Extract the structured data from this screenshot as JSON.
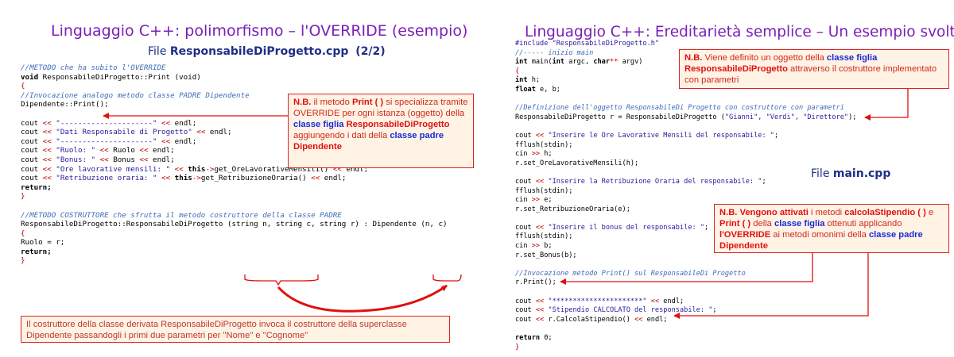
{
  "left": {
    "title": "Linguaggio C++: polimorfismo – l'OVERRIDE (esempio)",
    "file_prefix": "File ",
    "file_name": "ResponsabileDiProgetto.cpp",
    "file_page": "(2/2)",
    "code": [
      {
        "t": "cm",
        "v": "//METODO che ha subito l'OVERRIDE"
      },
      {
        "t": "mix",
        "parts": [
          [
            "kw",
            "void"
          ],
          [
            "n",
            " ResponsabileDiProgetto::Print (void)"
          ]
        ]
      },
      {
        "t": "op",
        "v": "{"
      },
      {
        "t": "cm",
        "v": "//Invocazione analogo metodo classe PADRE Dipendente"
      },
      {
        "t": "n",
        "v": "Dipendente::Print();"
      },
      {
        "t": "n",
        "v": ""
      },
      {
        "t": "mix",
        "parts": [
          [
            "n",
            "cout "
          ],
          [
            "op",
            "<<"
          ],
          [
            "st",
            " \"---------------------\" "
          ],
          [
            "op",
            "<<"
          ],
          [
            "n",
            " endl;"
          ]
        ]
      },
      {
        "t": "mix",
        "parts": [
          [
            "n",
            "cout "
          ],
          [
            "op",
            "<<"
          ],
          [
            "st",
            " \"Dati Responsabile di Progetto\" "
          ],
          [
            "op",
            "<<"
          ],
          [
            "n",
            " endl;"
          ]
        ]
      },
      {
        "t": "mix",
        "parts": [
          [
            "n",
            "cout "
          ],
          [
            "op",
            "<<"
          ],
          [
            "st",
            " \"---------------------\" "
          ],
          [
            "op",
            "<<"
          ],
          [
            "n",
            " endl;"
          ]
        ]
      },
      {
        "t": "mix",
        "parts": [
          [
            "n",
            "cout "
          ],
          [
            "op",
            "<<"
          ],
          [
            "st",
            " \"Ruolo: \" "
          ],
          [
            "op",
            "<<"
          ],
          [
            "n",
            " Ruolo "
          ],
          [
            "op",
            "<<"
          ],
          [
            "n",
            " endl;"
          ]
        ]
      },
      {
        "t": "mix",
        "parts": [
          [
            "n",
            "cout "
          ],
          [
            "op",
            "<<"
          ],
          [
            "st",
            " \"Bonus: \" "
          ],
          [
            "op",
            "<<"
          ],
          [
            "n",
            " Bonus "
          ],
          [
            "op",
            "<<"
          ],
          [
            "n",
            " endl;"
          ]
        ]
      },
      {
        "t": "mix",
        "parts": [
          [
            "n",
            "cout "
          ],
          [
            "op",
            "<<"
          ],
          [
            "st",
            " \"Ore lavorative mensili: \" "
          ],
          [
            "op",
            "<<"
          ],
          [
            "kw",
            " this"
          ],
          [
            "op",
            "->"
          ],
          [
            "n",
            "get_OreLavorativeMensili() "
          ],
          [
            "op",
            "<<"
          ],
          [
            "n",
            " endl;"
          ]
        ]
      },
      {
        "t": "mix",
        "parts": [
          [
            "n",
            "cout "
          ],
          [
            "op",
            "<<"
          ],
          [
            "st",
            " \"Retribuzione oraria: \" "
          ],
          [
            "op",
            "<<"
          ],
          [
            "kw",
            " this"
          ],
          [
            "op",
            "->"
          ],
          [
            "n",
            "get_RetribuzioneOraria() "
          ],
          [
            "op",
            "<<"
          ],
          [
            "n",
            " endl;"
          ]
        ]
      },
      {
        "t": "kw",
        "v": "return;"
      },
      {
        "t": "op",
        "v": "}"
      },
      {
        "t": "n",
        "v": ""
      },
      {
        "t": "cm",
        "v": "//METODO COSTRUTTORE che sfrutta il metodo costruttore della classe PADRE"
      },
      {
        "t": "n",
        "v": "ResponsabileDiProgetto::ResponsabileDiProgetto (string n, string c, string r) : Dipendente (n, c)"
      },
      {
        "t": "op",
        "v": "{"
      },
      {
        "t": "n",
        "v": "Ruolo = r;"
      },
      {
        "t": "kw",
        "v": "return;"
      },
      {
        "t": "op",
        "v": "}"
      }
    ],
    "note1": {
      "nb": "N.B.",
      "a": " il metodo ",
      "b": "Print ( )",
      "c": " si specializza tramite OVERRIDE per ogni istanza (oggetto) della ",
      "d": "classe figlia",
      "e": " ",
      "f": "ResponsabileDiProgetto",
      "g": " aggiungendo i dati della ",
      "h": "classe padre",
      "i": " ",
      "j": "Dipendente"
    },
    "note2": {
      "a": "Il costruttore della ",
      "b": "classe derivata",
      "c": " ",
      "d": "ResponsabileDiProgetto",
      "e": " invoca il costruttore della ",
      "f": "superclasse",
      "g": " ",
      "h": "Dipendente",
      "i": " passandogli i primi due parametri per \"Nome\" e \"Cognome\""
    }
  },
  "right": {
    "title": "Linguaggio C++: Ereditarietà semplice – Un esempio svolto",
    "file_prefix": "File ",
    "file_name": "main.cpp",
    "code": [
      {
        "t": "st",
        "v": "#include \"ResponsabileDiProgetto.h\""
      },
      {
        "t": "cm",
        "v": "//----- inizio main"
      },
      {
        "t": "mix",
        "parts": [
          [
            "kw",
            "int"
          ],
          [
            "n",
            " main("
          ],
          [
            "kw",
            "int"
          ],
          [
            "n",
            " argc, "
          ],
          [
            "kw",
            "char"
          ],
          [
            "op",
            "**"
          ],
          [
            "n",
            " argv)"
          ]
        ]
      },
      {
        "t": "op",
        "v": "{"
      },
      {
        "t": "mix",
        "parts": [
          [
            "kw",
            "int"
          ],
          [
            "n",
            " h;"
          ]
        ]
      },
      {
        "t": "mix",
        "parts": [
          [
            "kw",
            "float"
          ],
          [
            "n",
            " e, b;"
          ]
        ]
      },
      {
        "t": "n",
        "v": ""
      },
      {
        "t": "cm",
        "v": "//Definizione dell'oggetto ResponsabileDi Progetto con costruttore con parametri"
      },
      {
        "t": "mix",
        "parts": [
          [
            "n",
            "ResponsabileDiProgetto r = ResponsabileDiProgetto ("
          ],
          [
            "st",
            "\"Gianni\", \"Verdi\", \"Direttore\""
          ],
          [
            "n",
            ");"
          ]
        ]
      },
      {
        "t": "n",
        "v": ""
      },
      {
        "t": "mix",
        "parts": [
          [
            "n",
            "cout "
          ],
          [
            "op",
            "<<"
          ],
          [
            "st",
            " \"Inserire le Ore Lavorative Mensili del responsabile: \""
          ],
          [
            "n",
            ";"
          ]
        ]
      },
      {
        "t": "n",
        "v": "fflush(stdin);"
      },
      {
        "t": "mix",
        "parts": [
          [
            "n",
            "cin "
          ],
          [
            "op",
            ">>"
          ],
          [
            "n",
            " h;"
          ]
        ]
      },
      {
        "t": "n",
        "v": "r.set_OreLavorativeMensili(h);"
      },
      {
        "t": "n",
        "v": ""
      },
      {
        "t": "mix",
        "parts": [
          [
            "n",
            "cout "
          ],
          [
            "op",
            "<<"
          ],
          [
            "st",
            " \"Inserire la Retribuzione Oraria del responsabile: \""
          ],
          [
            "n",
            ";"
          ]
        ]
      },
      {
        "t": "n",
        "v": "fflush(stdin);"
      },
      {
        "t": "mix",
        "parts": [
          [
            "n",
            "cin "
          ],
          [
            "op",
            ">>"
          ],
          [
            "n",
            " e;"
          ]
        ]
      },
      {
        "t": "n",
        "v": "r.set_RetribuzioneOraria(e);"
      },
      {
        "t": "n",
        "v": ""
      },
      {
        "t": "mix",
        "parts": [
          [
            "n",
            "cout "
          ],
          [
            "op",
            "<<"
          ],
          [
            "st",
            " \"Inserire il bonus del responsabile: \""
          ],
          [
            "n",
            ";"
          ]
        ]
      },
      {
        "t": "n",
        "v": "fflush(stdin);"
      },
      {
        "t": "mix",
        "parts": [
          [
            "n",
            "cin "
          ],
          [
            "op",
            ">>"
          ],
          [
            "n",
            " b;"
          ]
        ]
      },
      {
        "t": "n",
        "v": "r.set_Bonus(b);"
      },
      {
        "t": "n",
        "v": ""
      },
      {
        "t": "cm",
        "v": "//Invocazione metodo Print() sul ResponsabileDi Progetto"
      },
      {
        "t": "n",
        "v": "r.Print();"
      },
      {
        "t": "n",
        "v": ""
      },
      {
        "t": "mix",
        "parts": [
          [
            "n",
            "cout "
          ],
          [
            "op",
            "<<"
          ],
          [
            "st",
            " \"**********************\" "
          ],
          [
            "op",
            "<<"
          ],
          [
            "n",
            " endl;"
          ]
        ]
      },
      {
        "t": "mix",
        "parts": [
          [
            "n",
            "cout "
          ],
          [
            "op",
            "<<"
          ],
          [
            "st",
            " \"Stipendio CALCOLATO del responsabile: \""
          ],
          [
            "n",
            ";"
          ]
        ]
      },
      {
        "t": "mix",
        "parts": [
          [
            "n",
            "cout "
          ],
          [
            "op",
            "<<"
          ],
          [
            "n",
            " r.CalcolaStipendio() "
          ],
          [
            "op",
            "<<"
          ],
          [
            "n",
            " endl;"
          ]
        ]
      },
      {
        "t": "n",
        "v": ""
      },
      {
        "t": "mix",
        "parts": [
          [
            "kw",
            "return"
          ],
          [
            "n",
            " 0;"
          ]
        ]
      },
      {
        "t": "op",
        "v": "}"
      }
    ],
    "note1": {
      "nb": "N.B.",
      "a": " Viene definito un oggetto della ",
      "b": "classe figlia",
      "c": " ",
      "d": "ResponsabileDiProgetto",
      "e": " attraverso il costruttore implementato con parametri"
    },
    "note2": {
      "nb": "N.B.",
      "a": "  ",
      "b": "Vengono attivati",
      "c": " i metodi ",
      "d": "calcolaStipendio ( )",
      "e": " e ",
      "f": "Print ( )",
      "g": " della ",
      "h": "classe figlia",
      "i": " ottenuti applicando ",
      "j": "l'OVERRIDE",
      "k": " ai metodi omonimi della ",
      "l": "classe padre",
      "m": " ",
      "n": "Dipendente"
    }
  },
  "colors": {
    "title": "#7a1fb8",
    "file_label": "#1f2f86",
    "comment": "#3d6bb8",
    "string": "#2a1a9a",
    "operator": "#c00000",
    "note_border": "#dd2222",
    "note_bg": "#fff3e6",
    "note_red": "#e01010",
    "note_blue": "#1a2bd6",
    "arrow": "#e01010"
  }
}
